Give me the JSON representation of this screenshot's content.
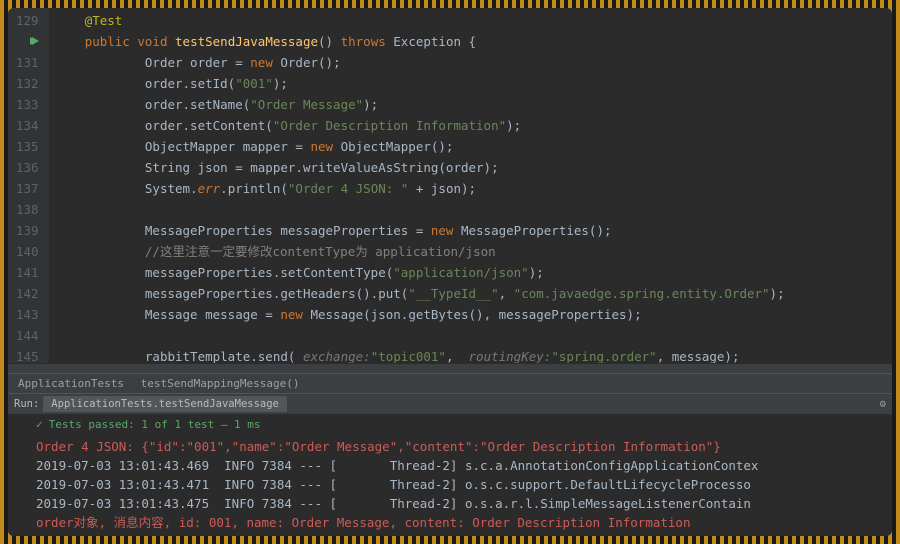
{
  "lines_start": 129,
  "lines_end": 147,
  "run_line": 130,
  "code": {
    "129": [
      {
        "t": "@Test",
        "c": "ann"
      }
    ],
    "130": [
      {
        "t": "public ",
        "c": "kw"
      },
      {
        "t": "void ",
        "c": "kw"
      },
      {
        "t": "testSendJavaMessage",
        "c": "fn"
      },
      {
        "t": "() "
      },
      {
        "t": "throws ",
        "c": "kw"
      },
      {
        "t": "Exception {"
      }
    ],
    "131": [
      {
        "t": "    Order order = "
      },
      {
        "t": "new ",
        "c": "kw"
      },
      {
        "t": "Order();"
      }
    ],
    "132": [
      {
        "t": "    order.setId("
      },
      {
        "t": "\"001\"",
        "c": "str"
      },
      {
        "t": ");"
      }
    ],
    "133": [
      {
        "t": "    order.setName("
      },
      {
        "t": "\"Order Message\"",
        "c": "str"
      },
      {
        "t": ");"
      }
    ],
    "134": [
      {
        "t": "    order.setContent("
      },
      {
        "t": "\"Order Description Information\"",
        "c": "str"
      },
      {
        "t": ");"
      }
    ],
    "135": [
      {
        "t": "    ObjectMapper mapper = "
      },
      {
        "t": "new ",
        "c": "kw"
      },
      {
        "t": "ObjectMapper();"
      }
    ],
    "136": [
      {
        "t": "    String json = mapper.writeValueAsString(order);"
      }
    ],
    "137": [
      {
        "t": "    System."
      },
      {
        "t": "err",
        "c": "err"
      },
      {
        "t": ".println("
      },
      {
        "t": "\"Order 4 JSON: \"",
        "c": "str"
      },
      {
        "t": " + json);"
      }
    ],
    "138": [],
    "139": [
      {
        "t": "    MessageProperties messageProperties = "
      },
      {
        "t": "new ",
        "c": "kw"
      },
      {
        "t": "MessageProperties();"
      }
    ],
    "140": [
      {
        "t": "    //这里注意一定要修改contentType为 application/json",
        "c": "cmt"
      }
    ],
    "141": [
      {
        "t": "    messageProperties.setContentType("
      },
      {
        "t": "\"application/json\"",
        "c": "str"
      },
      {
        "t": ");"
      }
    ],
    "142": [
      {
        "t": "    messageProperties.getHeaders().put("
      },
      {
        "t": "\"__TypeId__\"",
        "c": "str"
      },
      {
        "t": ", "
      },
      {
        "t": "\"com.javaedge.spring.entity.Order\"",
        "c": "str"
      },
      {
        "t": ");"
      }
    ],
    "143": [
      {
        "t": "    Message message = "
      },
      {
        "t": "new ",
        "c": "kw"
      },
      {
        "t": "Message(json.getBytes(), messageProperties);"
      }
    ],
    "144": [],
    "145": [
      {
        "t": "    rabbitTemplate.send( "
      },
      {
        "t": "exchange:",
        "c": "hint"
      },
      {
        "t": "\"topic001\"",
        "c": "str"
      },
      {
        "t": ",  "
      },
      {
        "t": "routingKey:",
        "c": "hint"
      },
      {
        "t": "\"spring.order\"",
        "c": "str"
      },
      {
        "t": ", message);"
      }
    ],
    "146": [
      {
        "t": "}"
      }
    ],
    "147": []
  },
  "breadcrumbs": [
    "ApplicationTests",
    "testSendMappingMessage()"
  ],
  "run": {
    "label": "Run:",
    "tab": "ApplicationTests.testSendJavaMessage",
    "status": "Tests passed: 1 of 1 test – 1 ms"
  },
  "console": [
    {
      "c": "err",
      "t": "Order 4 JSON: {\"id\":\"001\",\"name\":\"Order Message\",\"content\":\"Order Description Information\"}"
    },
    {
      "c": "info",
      "t": "2019-07-03 13:01:43.469  INFO 7384 --- [       Thread-2] s.c.a.AnnotationConfigApplicationContex"
    },
    {
      "c": "info",
      "t": "2019-07-03 13:01:43.471  INFO 7384 --- [       Thread-2] o.s.c.support.DefaultLifecycleProcesso"
    },
    {
      "c": "info",
      "t": "2019-07-03 13:01:43.475  INFO 7384 --- [       Thread-2] o.s.a.r.l.SimpleMessageListenerContain"
    },
    {
      "c": "err",
      "t": "order对象, 消息内容, id: 001, name: Order Message, content: Order Description Information"
    }
  ]
}
